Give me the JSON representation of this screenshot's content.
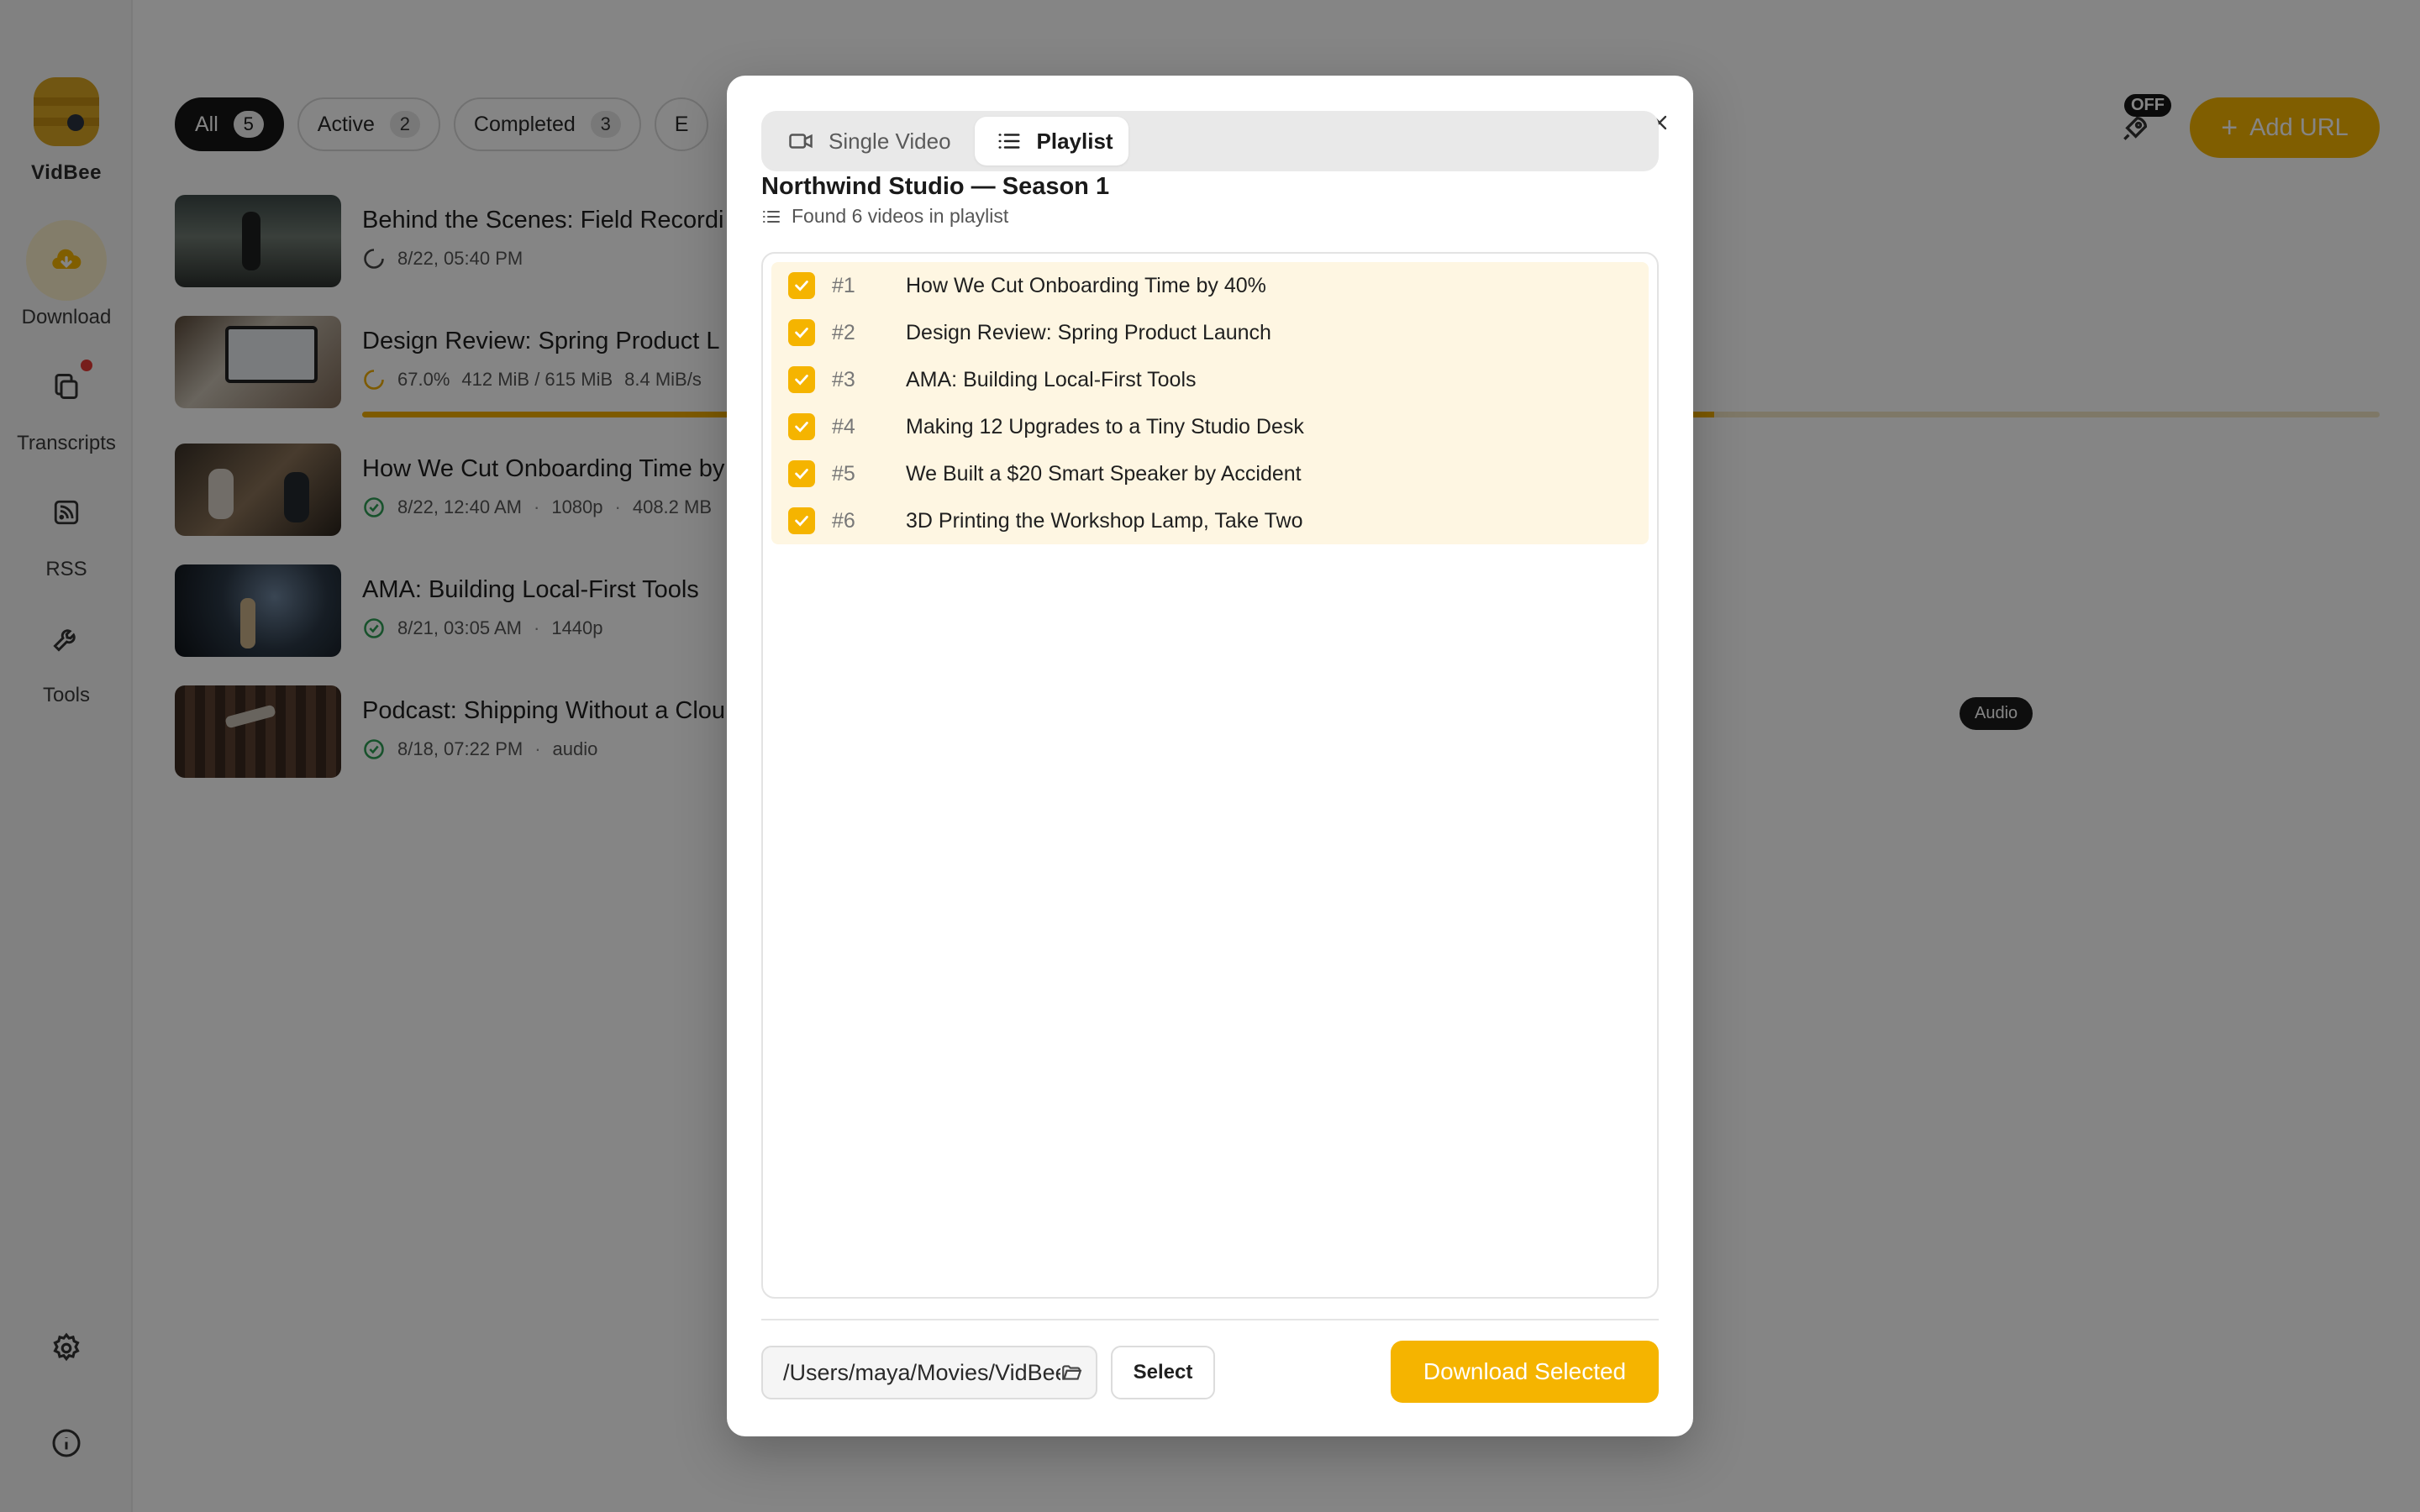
{
  "app": {
    "name": "VidBee"
  },
  "sidebar": {
    "items": [
      {
        "label": "Download",
        "icon": "download-cloud-icon"
      },
      {
        "label": "Transcripts",
        "icon": "copy-icon"
      },
      {
        "label": "RSS",
        "icon": "rss-icon"
      },
      {
        "label": "Tools",
        "icon": "wrench-icon"
      }
    ],
    "bottom": [
      "settings-gear-icon",
      "info-icon"
    ]
  },
  "filters": [
    {
      "label": "All",
      "count": "5"
    },
    {
      "label": "Active",
      "count": "2"
    },
    {
      "label": "Completed",
      "count": "3"
    },
    {
      "label": "E"
    }
  ],
  "header": {
    "boost_badge": "OFF",
    "add_url_label": "Add URL"
  },
  "downloads": [
    {
      "title": "Behind the Scenes: Field Recordi",
      "date": "8/22, 05:40 PM"
    },
    {
      "title": "Design Review: Spring Product L",
      "percent": "67.0%",
      "size": "412 MiB / 615 MiB",
      "speed": "8.4 MiB/s",
      "progress": 0.67
    },
    {
      "title": "How We Cut Onboarding Time by",
      "date": "8/22, 12:40 AM",
      "quality": "1080p",
      "size": "408.2 MB"
    },
    {
      "title": "AMA: Building Local-First Tools",
      "date": "8/21, 03:05 AM",
      "quality": "1440p"
    },
    {
      "title": "Podcast: Shipping Without a Clou",
      "date": "8/18, 07:22 PM",
      "quality": "audio"
    }
  ],
  "audio_badge": "Audio",
  "modal": {
    "tabs": {
      "single": "Single Video",
      "playlist": "Playlist"
    },
    "playlist_title": "Northwind Studio — Season 1",
    "found_text": "Found 6 videos in playlist",
    "items": [
      {
        "num": "#1",
        "title": "How We Cut Onboarding Time by 40%"
      },
      {
        "num": "#2",
        "title": "Design Review: Spring Product Launch"
      },
      {
        "num": "#3",
        "title": "AMA: Building Local-First Tools"
      },
      {
        "num": "#4",
        "title": "Making 12 Upgrades to a Tiny Studio Desk"
      },
      {
        "num": "#5",
        "title": "We Built a $20 Smart Speaker by Accident"
      },
      {
        "num": "#6",
        "title": "3D Printing the Workshop Lamp, Take Two"
      }
    ],
    "path": "/Users/maya/Movies/VidBee",
    "select_label": "Select",
    "download_label": "Download Selected"
  },
  "colors": {
    "accent": "#f5b400",
    "success": "#2e9d55"
  }
}
